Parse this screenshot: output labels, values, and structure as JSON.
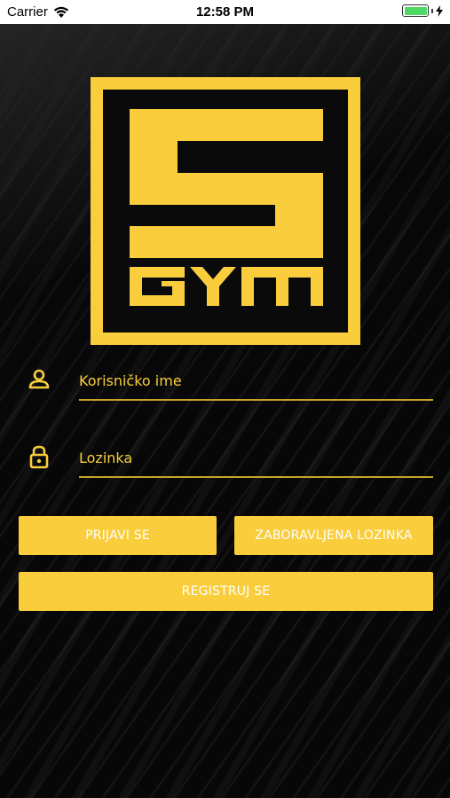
{
  "status_bar": {
    "carrier": "Carrier",
    "time": "12:58 PM",
    "battery_level": 1.0,
    "battery_color": "#4cd964"
  },
  "logo": {
    "text": "S GYM",
    "color": "#f9cd3c"
  },
  "form": {
    "username": {
      "placeholder": "Korisničko ime",
      "value": "",
      "icon": "person-icon"
    },
    "password": {
      "placeholder": "Lozinka",
      "value": "",
      "icon": "lock-icon"
    }
  },
  "buttons": {
    "login": "PRIJAVI SE",
    "forgot": "ZABORAVLJENA LOZINKA",
    "register": "REGISTRUJ SE"
  },
  "colors": {
    "accent": "#f9cd3c",
    "background": "#0a0a0a",
    "button_text": "#ffffff"
  }
}
